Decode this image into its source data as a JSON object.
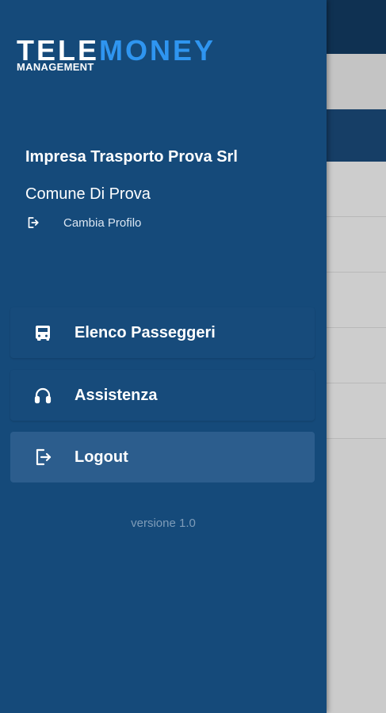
{
  "logo": {
    "part1": "TELE",
    "part2": "MONEY",
    "sub": "MANAGEMENT"
  },
  "profile": {
    "company": "Impresa Trasporto Prova Srl",
    "comune": "Comune Di Prova",
    "cambia_label": "Cambia Profilo"
  },
  "menu": {
    "items": [
      {
        "label": "Elenco Passeggeri",
        "icon": "bus-icon"
      },
      {
        "label": "Assistenza",
        "icon": "headset-icon"
      },
      {
        "label": "Logout",
        "icon": "logout-icon"
      }
    ]
  },
  "footer": {
    "version": "versione 1.0"
  },
  "colors": {
    "drawer_bg": "#154a7a",
    "logo_accent": "#2f95f0",
    "active_item_bg": "#2c5d8d"
  }
}
